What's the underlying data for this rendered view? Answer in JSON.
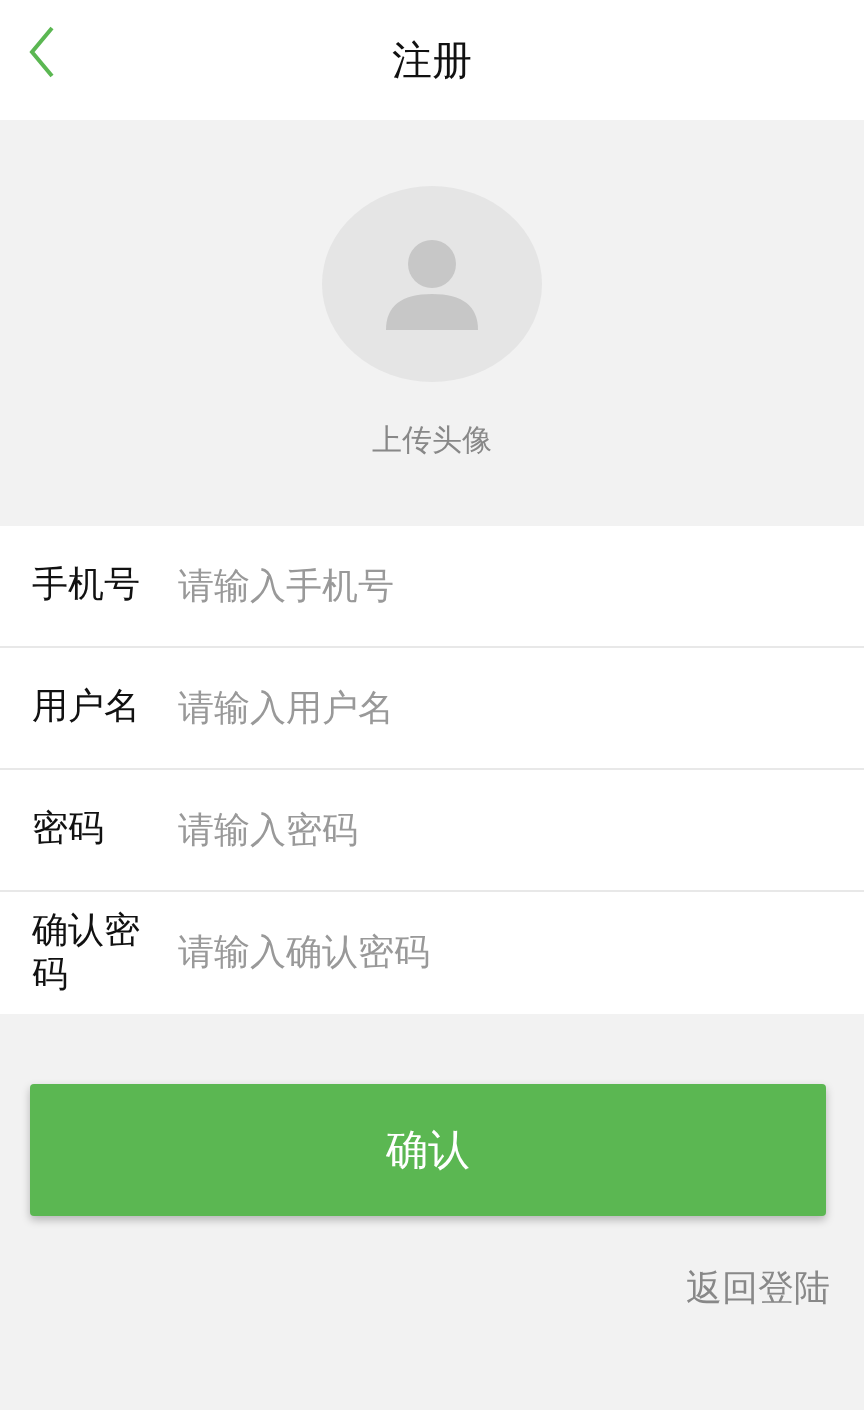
{
  "header": {
    "title": "注册"
  },
  "avatar": {
    "label": "上传头像"
  },
  "fields": [
    {
      "label": "手机号",
      "placeholder": "请输入手机号"
    },
    {
      "label": "用户名",
      "placeholder": "请输入用户名"
    },
    {
      "label": "密码",
      "placeholder": "请输入密码"
    },
    {
      "label": "确认密码",
      "placeholder": "请输入确认密码"
    }
  ],
  "confirm_button": "确认",
  "back_link": "返回登陆"
}
